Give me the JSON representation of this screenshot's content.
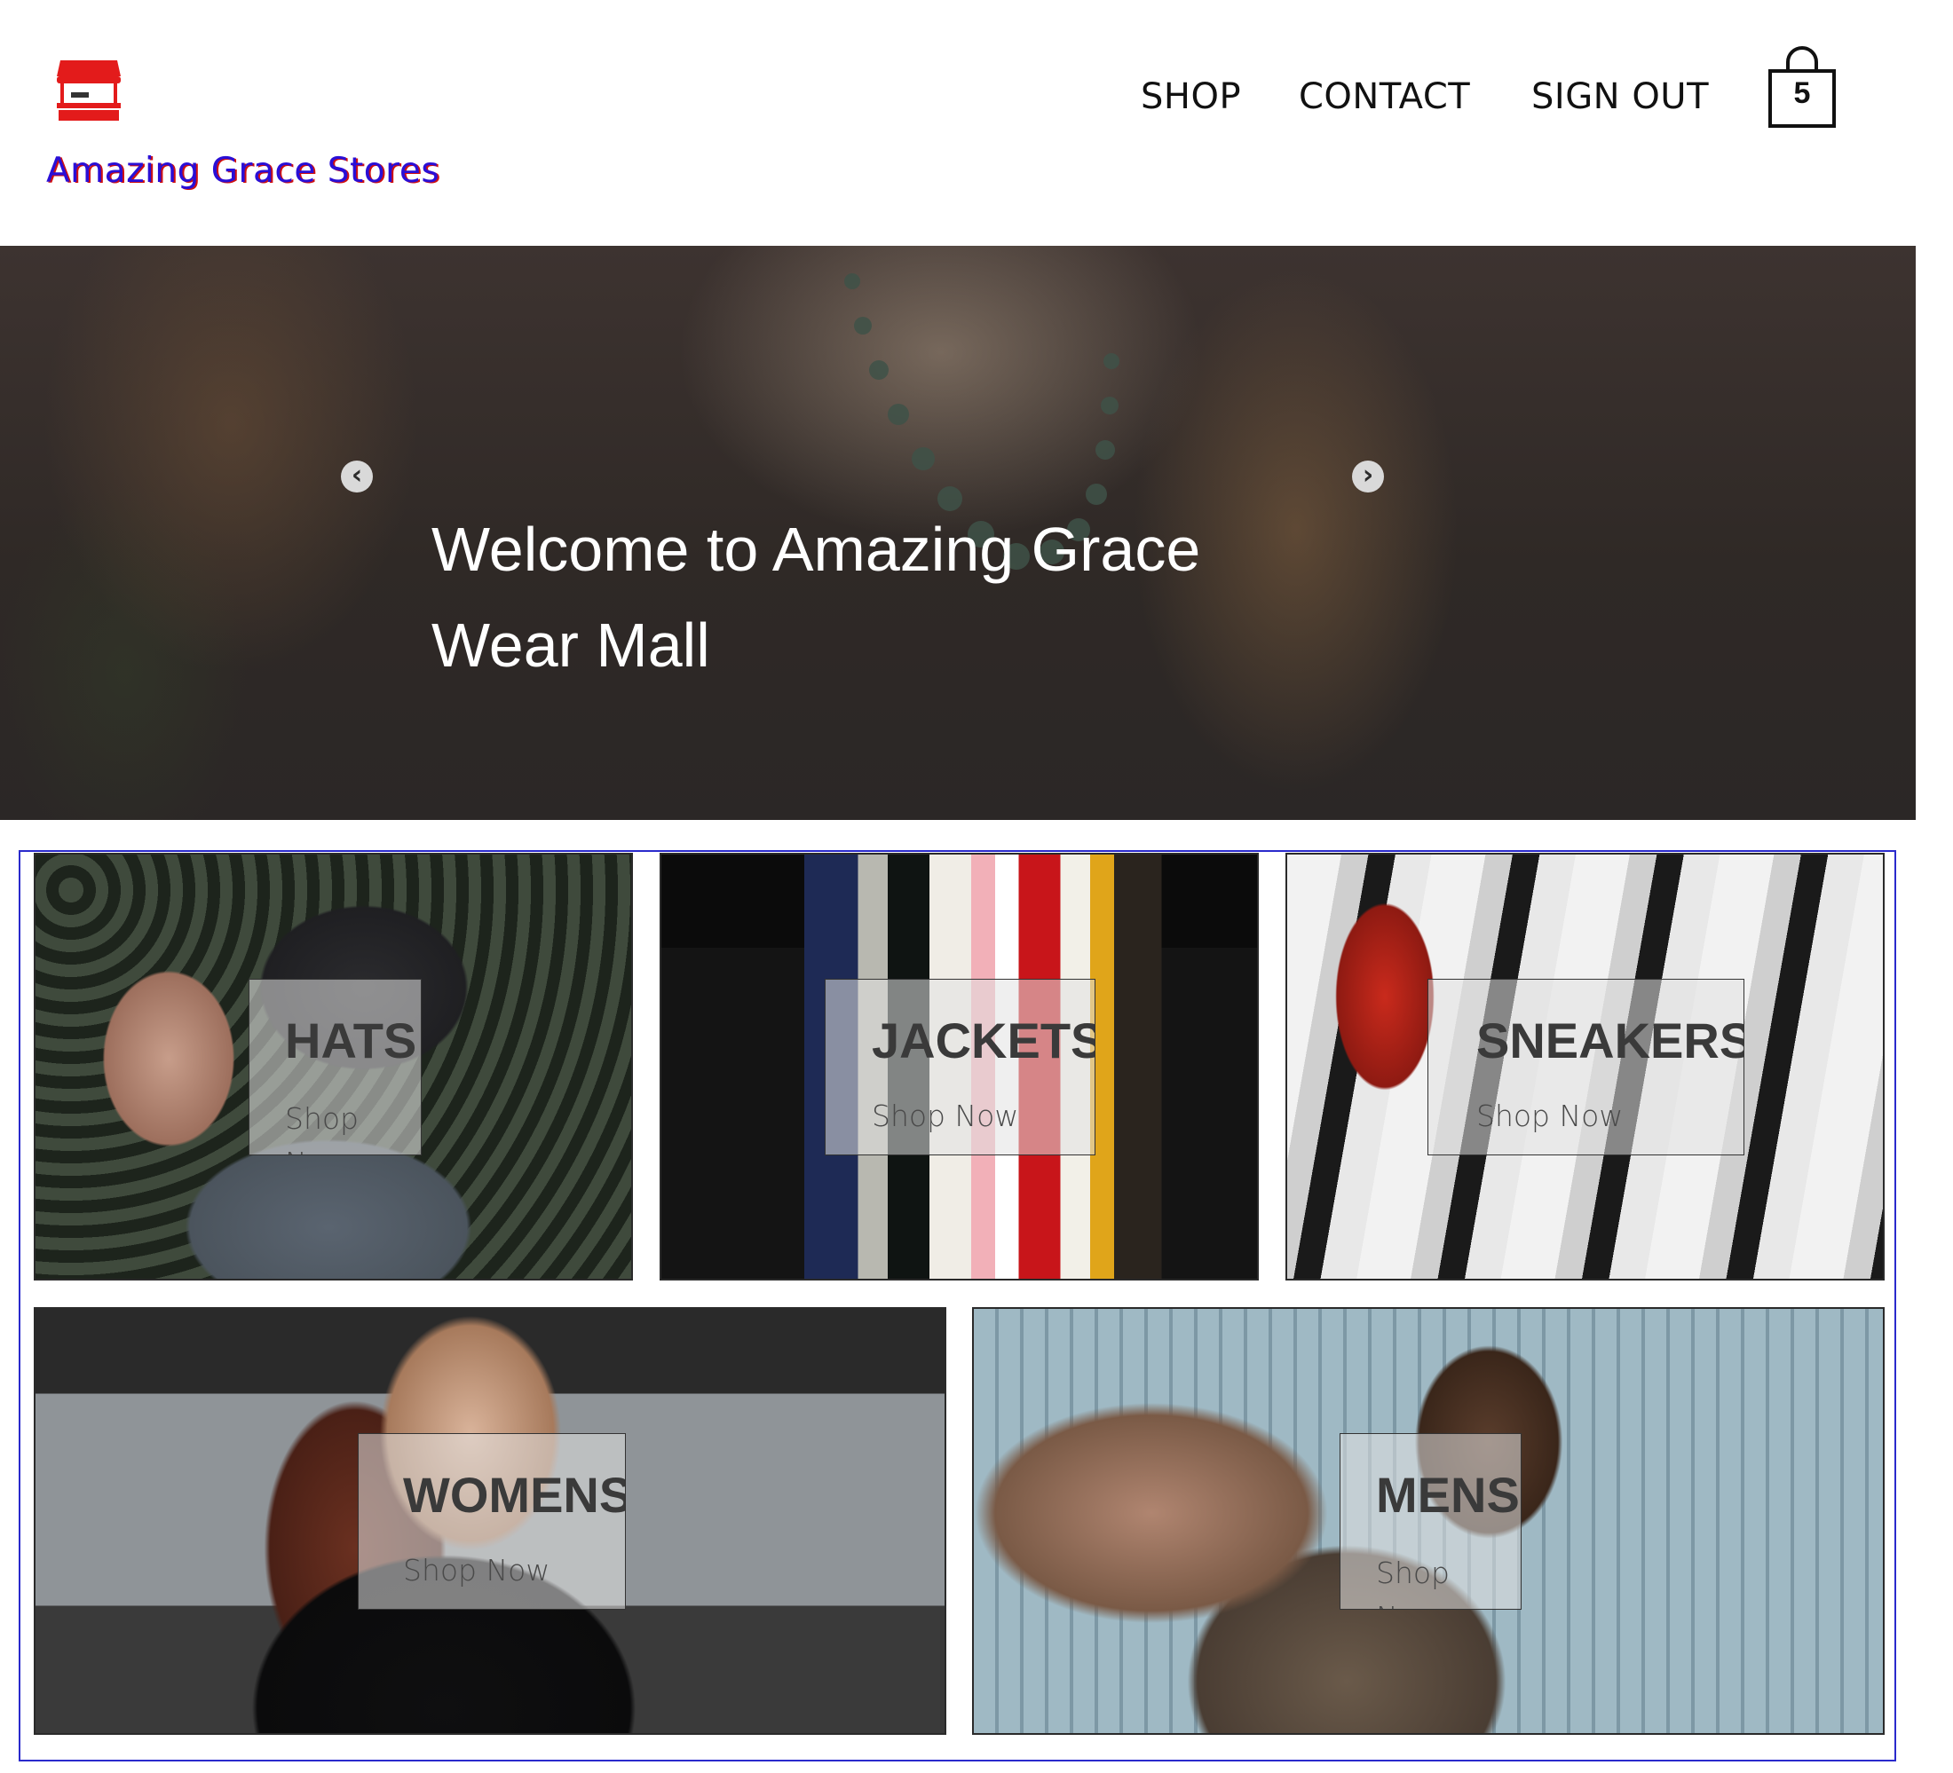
{
  "header": {
    "brand": "Amazing Grace Stores",
    "logo_icon": "store-icon",
    "nav": [
      "SHOP",
      "CONTACT",
      "SIGN OUT"
    ],
    "cart": {
      "icon": "shopping-bag-icon",
      "count": "5"
    }
  },
  "hero": {
    "title": "Welcome to Amazing Grace Wear Mall",
    "prev_icon": "chevron-left-icon",
    "next_icon": "chevron-right-icon"
  },
  "categories": [
    {
      "title": "HATS",
      "cta": "Shop Now"
    },
    {
      "title": "JACKETS",
      "cta": "Shop Now"
    },
    {
      "title": "SNEAKERS",
      "cta": "Shop Now"
    },
    {
      "title": "WOMENS",
      "cta": "Shop Now"
    },
    {
      "title": "MENS",
      "cta": "Shop Now"
    }
  ],
  "colors": {
    "brand": "#2a0fd6",
    "brand_shadow": "#d01010",
    "logo": "#e31b1b",
    "grid_border": "#2a2acc"
  }
}
